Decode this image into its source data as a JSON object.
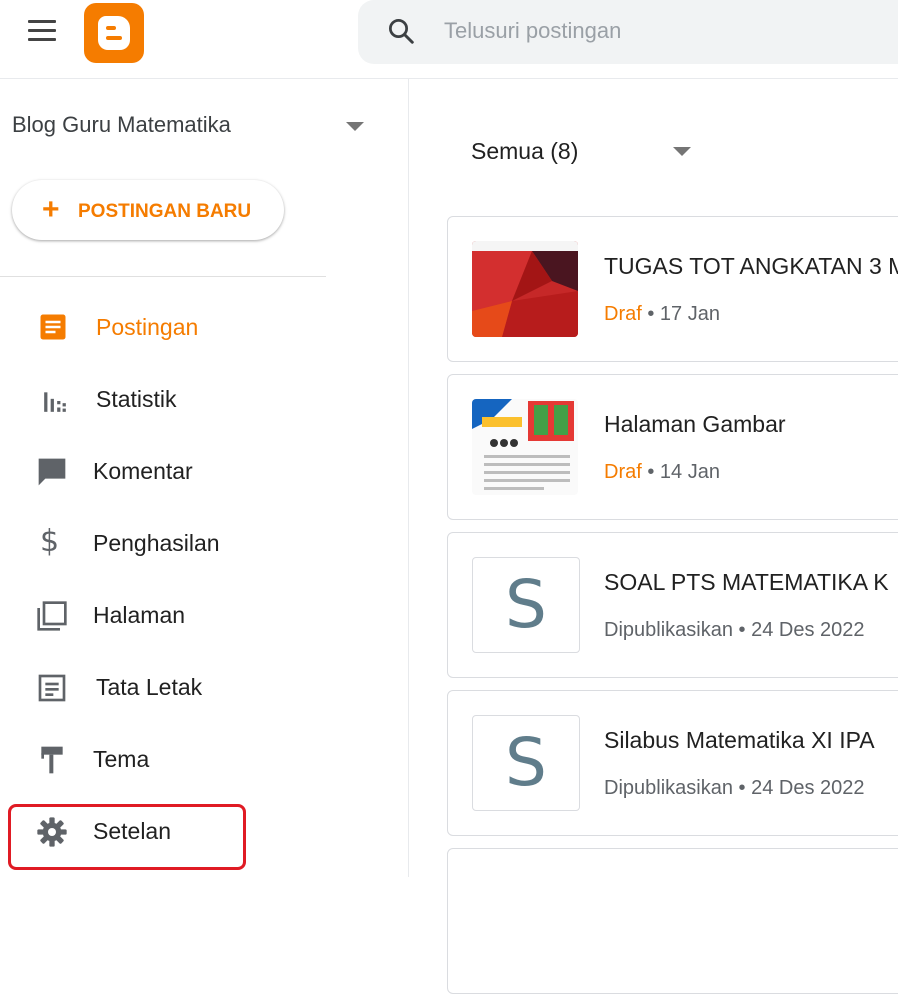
{
  "search": {
    "placeholder": "Telusuri postingan"
  },
  "sidebar": {
    "blog_name": "Blog Guru Matematika",
    "new_post_label": "POSTINGAN BARU",
    "items": [
      {
        "label": "Postingan",
        "icon": "posts-icon",
        "active": true
      },
      {
        "label": "Statistik",
        "icon": "stats-icon"
      },
      {
        "label": "Komentar",
        "icon": "comment-icon"
      },
      {
        "label": "Penghasilan",
        "icon": "dollar-icon"
      },
      {
        "label": "Halaman",
        "icon": "pages-icon"
      },
      {
        "label": "Tata Letak",
        "icon": "layout-icon"
      },
      {
        "label": "Tema",
        "icon": "paint-roller-icon"
      },
      {
        "label": "Setelan",
        "icon": "gear-icon"
      }
    ]
  },
  "main": {
    "filter_label": "Semua (8)",
    "posts": [
      {
        "title": "TUGAS TOT ANGKATAN 3 M",
        "status": "Draf",
        "date": "17 Jan"
      },
      {
        "title": "Halaman Gambar",
        "status": "Draf",
        "date": "14 Jan"
      },
      {
        "title": "SOAL PTS MATEMATIKA K",
        "status": "Dipublikasikan",
        "date": "24 Des 2022",
        "thumb_letter": "S"
      },
      {
        "title": "Silabus Matematika XI IPA",
        "status": "Dipublikasikan",
        "date": "24 Des 2022",
        "thumb_letter": "S"
      }
    ],
    "meta_separator": " • "
  },
  "colors": {
    "accent": "#f57c00",
    "annotation": "#e01b24",
    "text": "#212121",
    "muted": "#5f6368"
  }
}
